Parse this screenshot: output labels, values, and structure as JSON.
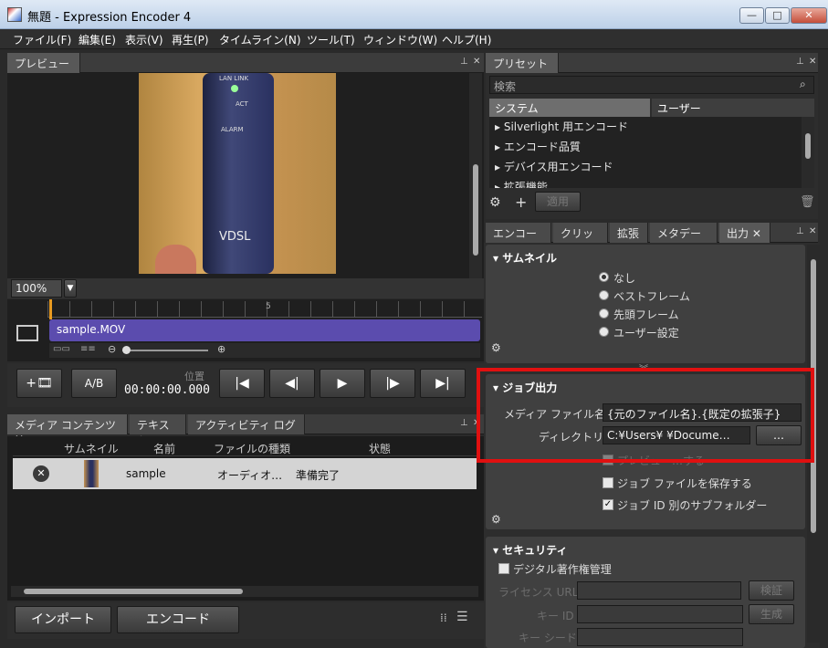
{
  "window": {
    "title": "無題 - Expression Encoder 4"
  },
  "menu": [
    "ファイル(F)",
    "編集(E)",
    "表示(V)",
    "再生(P)",
    "タイムライン(N)",
    "ツール(T)",
    "ウィンドウ(W)",
    "ヘルプ(H)"
  ],
  "preview": {
    "tab": "プレビュー",
    "zoom": "100%",
    "device_labels": [
      "LAN LINK",
      "ACT",
      "ALARM",
      "VDSL"
    ]
  },
  "timeline": {
    "tick": "5",
    "clip": "sample.MOV"
  },
  "transport": {
    "ab": "A/B",
    "position_label": "位置",
    "timecode": "00:00:00.000"
  },
  "media": {
    "tabs": [
      "メディア コンテンツ",
      "テキスト",
      "アクティビティ ログ"
    ],
    "columns": [
      "サムネイル",
      "名前",
      "ファイルの種類",
      "状態"
    ],
    "rows": [
      {
        "name": "sample",
        "type": "オーディオ…",
        "status": "準備完了"
      }
    ],
    "import_label": "インポート",
    "encode_label": "エンコード"
  },
  "presets": {
    "tab": "プリセット",
    "search_placeholder": "検索",
    "tabs": [
      "システム",
      "ユーザー"
    ],
    "items": [
      "Silverlight 用エンコード",
      "エンコード品質",
      "デバイス用エンコード",
      "拡張機能"
    ],
    "apply_label": "適用"
  },
  "settings": {
    "tabs": [
      "エンコード",
      "クリップ",
      "拡張",
      "メタデータ",
      "出力"
    ],
    "thumbnail": {
      "title": "サムネイル",
      "options": [
        "なし",
        "ベストフレーム",
        "先頭フレーム",
        "ユーザー設定"
      ]
    },
    "job": {
      "title": "ジョブ出力",
      "media_label": "メディア ファイル名",
      "media_value": "{元のファイル名}.{既定の拡張子}",
      "dir_label": "ディレクトリ",
      "dir_value": "C:¥Users¥       ¥Docume…",
      "browse": "…",
      "preview_label": "プレビュー…する",
      "save_job": "ジョブ ファイルを保存する",
      "subfolder": "ジョブ ID 別のサブフォルダー"
    },
    "security": {
      "title": "セキュリティ",
      "drm": "デジタル著作権管理",
      "license_label": "ライセンス URL",
      "verify": "検証",
      "key_id_label": "キー ID",
      "generate": "生成",
      "key_seed_label": "キー シード"
    }
  },
  "colors": {
    "highlight": "#e01010",
    "clip": "#5b4cae"
  }
}
